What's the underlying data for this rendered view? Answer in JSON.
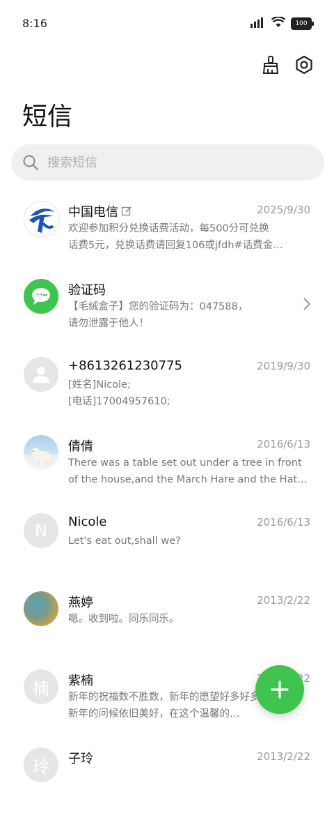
{
  "status_bar": {
    "time": "8:16",
    "battery": "100"
  },
  "header": {
    "title": "短信"
  },
  "search": {
    "placeholder": "搜索短信"
  },
  "conversations": [
    {
      "name": "中国电信",
      "date": "2025/9/30",
      "preview": [
        "欢迎参加积分兑换话费活动，每500分可兑换",
        "话费5元，兑换话费请回复106或jfdh#话费金…"
      ],
      "avatar": "telecom-logo"
    },
    {
      "name": "验证码",
      "date": "",
      "preview": [
        "【毛绒盒子】您的验证码为：047588，",
        "请勿泄露于他人！"
      ],
      "avatar": "sms-bubble"
    },
    {
      "name": "+8613261230775",
      "date": "2019/9/30",
      "preview": [
        "[姓名]Nicole;",
        "[电话]17004957610;"
      ],
      "avatar": "person"
    },
    {
      "name": "倩倩",
      "date": "2016/6/13",
      "preview": [
        "There was a table set out under a tree in front",
        "of the house,and the March Hare and the Hatte…"
      ],
      "avatar": "polar-bear-photo"
    },
    {
      "name": "Nicole",
      "date": "2016/6/13",
      "preview": [
        "Let's eat out,shall we?"
      ],
      "avatar": "N"
    },
    {
      "name": "燕婷",
      "date": "2013/2/22",
      "preview": [
        "嗯。收到啦。同乐同乐。"
      ],
      "avatar": "landscape-photo"
    },
    {
      "name": "紫楠",
      "date": "2013/2/22",
      "preview": [
        "新年的祝福数不胜数，新年的愿望好多好多，",
        "新年的问候依旧美好，在这个温馨的…"
      ],
      "avatar": "楠"
    },
    {
      "name": "子玲",
      "date": "2013/2/22",
      "preview": [
        "",
        ""
      ],
      "avatar": "玲"
    }
  ],
  "colors": {
    "accent": "#3fc54f",
    "telecom_blue": "#1a56b0"
  }
}
